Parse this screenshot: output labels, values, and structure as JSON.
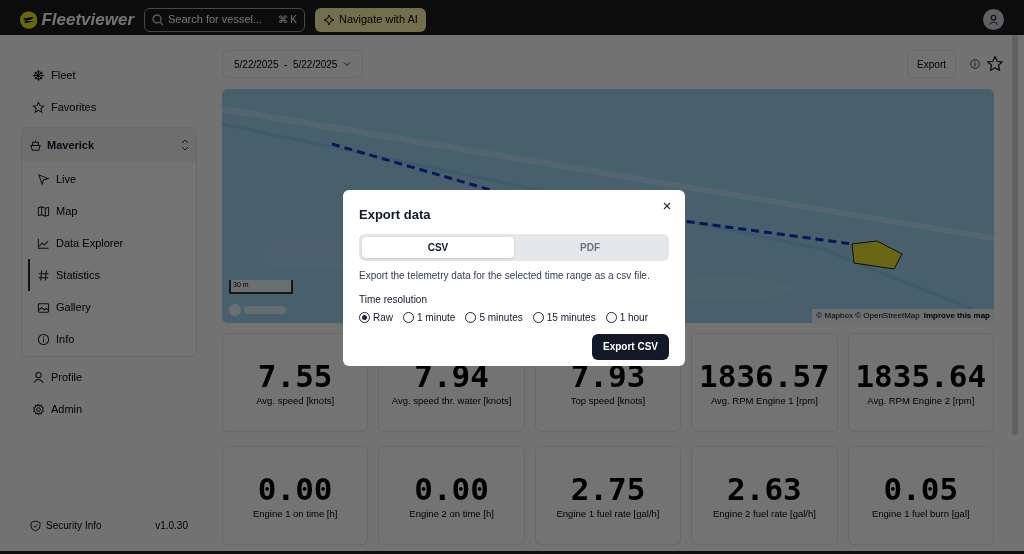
{
  "header": {
    "logo_text": "Fleetviewer",
    "search": {
      "placeholder": "Search for vessel...",
      "shortcut": "⌘ K"
    },
    "ai_button": "Navigate with AI"
  },
  "sidebar": {
    "top_items": [
      {
        "label": "Fleet",
        "selected": false
      },
      {
        "label": "Favorites",
        "selected": false
      }
    ],
    "vessel": {
      "name": "Maverick",
      "expanded": true,
      "children": [
        {
          "label": "Live",
          "selected": false
        },
        {
          "label": "Map",
          "selected": false
        },
        {
          "label": "Data Explorer",
          "selected": false
        },
        {
          "label": "Statistics",
          "selected": true
        },
        {
          "label": "Gallery",
          "selected": false
        },
        {
          "label": "Info",
          "selected": false
        }
      ]
    },
    "bottom_items": [
      {
        "label": "Profile",
        "selected": false
      },
      {
        "label": "Admin",
        "selected": false
      }
    ],
    "footer": {
      "security": "Security Info",
      "version": "v1.0.30"
    }
  },
  "toolbar": {
    "date_range": "5/22/2025  -  5/22/2025",
    "export_button": "Export"
  },
  "map": {
    "kind": "picture",
    "scale": "30 m",
    "attribution": "© Mapbox © OpenStreetMap",
    "improve_link": "Improve this map"
  },
  "stats": [
    {
      "value": "7.55",
      "label": "Avg. speed [knots]"
    },
    {
      "value": "7.94",
      "label": "Avg. speed thr. water [knots]"
    },
    {
      "value": "7.93",
      "label": "Top speed [knots]"
    },
    {
      "value": "1836.57",
      "label": "Avg. RPM Engine 1 [rpm]"
    },
    {
      "value": "1835.64",
      "label": "Avg. RPM Engine 2 [rpm]"
    },
    {
      "value": "0.00",
      "label": "Engine 1 on time [h]"
    },
    {
      "value": "0.00",
      "label": "Engine 2 on time [h]"
    },
    {
      "value": "2.75",
      "label": "Engine 1 fuel rate [gal/h]"
    },
    {
      "value": "2.63",
      "label": "Engine 2 fuel rate [gal/h]"
    },
    {
      "value": "0.05",
      "label": "Engine 1 fuel burn [gal]"
    }
  ],
  "modal": {
    "title": "Export data",
    "tabs": [
      {
        "label": "CSV",
        "selected": true
      },
      {
        "label": "PDF",
        "selected": false
      }
    ],
    "description": "Export the telemetry data for the selected time range as a csv file.",
    "resolution_label": "Time resolution",
    "options": [
      {
        "label": "Raw",
        "selected": true
      },
      {
        "label": "1 minute",
        "selected": false
      },
      {
        "label": "5 minutes",
        "selected": false
      },
      {
        "label": "15 minutes",
        "selected": false
      },
      {
        "label": "1 hour",
        "selected": false
      }
    ],
    "button": "Export CSV"
  }
}
